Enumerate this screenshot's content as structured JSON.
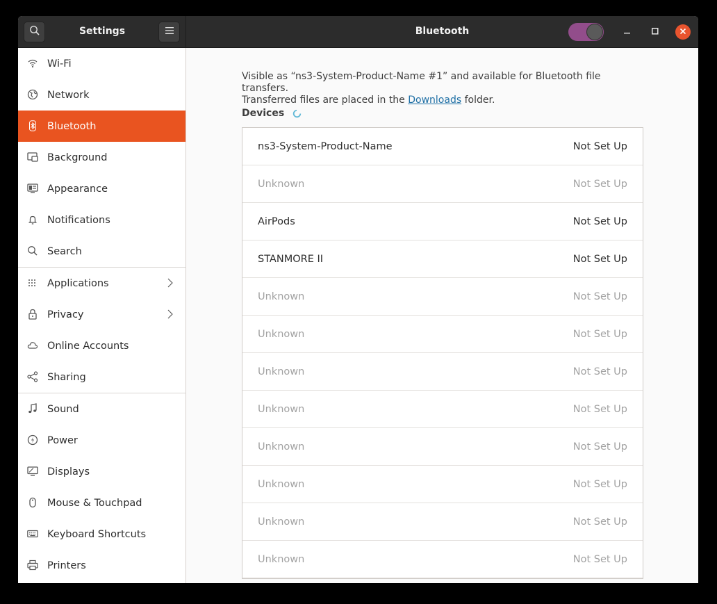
{
  "header": {
    "left_title": "Settings",
    "title": "Bluetooth",
    "search_icon": "search-icon",
    "menu_icon": "hamburger-menu-icon",
    "toggle_on": true,
    "accent": "#e95420",
    "toggle_color": "#924d8b"
  },
  "sidebar": {
    "items": [
      {
        "label": "Wi-Fi",
        "icon": "wifi-icon"
      },
      {
        "label": "Network",
        "icon": "network-globe-icon"
      },
      {
        "label": "Bluetooth",
        "icon": "bluetooth-icon"
      },
      {
        "label": "Background",
        "icon": "background-icon"
      },
      {
        "label": "Appearance",
        "icon": "appearance-icon"
      },
      {
        "label": "Notifications",
        "icon": "bell-icon"
      },
      {
        "label": "Search",
        "icon": "search-icon"
      },
      {
        "label": "Applications",
        "icon": "apps-grid-icon"
      },
      {
        "label": "Privacy",
        "icon": "lock-icon"
      },
      {
        "label": "Online Accounts",
        "icon": "cloud-icon"
      },
      {
        "label": "Sharing",
        "icon": "share-icon"
      },
      {
        "label": "Sound",
        "icon": "music-note-icon"
      },
      {
        "label": "Power",
        "icon": "power-icon"
      },
      {
        "label": "Displays",
        "icon": "display-icon"
      },
      {
        "label": "Mouse & Touchpad",
        "icon": "mouse-icon"
      },
      {
        "label": "Keyboard Shortcuts",
        "icon": "keyboard-icon"
      },
      {
        "label": "Printers",
        "icon": "printer-icon"
      }
    ]
  },
  "main": {
    "info_line1": "Visible as “ns3-System-Product-Name #1” and available for Bluetooth file transfers.",
    "info_line2_pre": "Transferred files are placed in the ",
    "info_link": "Downloads",
    "info_line2_post": " folder.",
    "devices_heading": "Devices",
    "devices": [
      {
        "name": "ns3-System-Product-Name",
        "status": "Not Set Up"
      },
      {
        "name": "Unknown",
        "status": "Not Set Up"
      },
      {
        "name": "AirPods",
        "status": "Not Set Up"
      },
      {
        "name": "STANMORE II",
        "status": "Not Set Up"
      },
      {
        "name": "Unknown",
        "status": "Not Set Up"
      },
      {
        "name": "Unknown",
        "status": "Not Set Up"
      },
      {
        "name": "Unknown",
        "status": "Not Set Up"
      },
      {
        "name": "Unknown",
        "status": "Not Set Up"
      },
      {
        "name": "Unknown",
        "status": "Not Set Up"
      },
      {
        "name": "Unknown",
        "status": "Not Set Up"
      },
      {
        "name": "Unknown",
        "status": "Not Set Up"
      },
      {
        "name": "Unknown",
        "status": "Not Set Up"
      }
    ]
  }
}
